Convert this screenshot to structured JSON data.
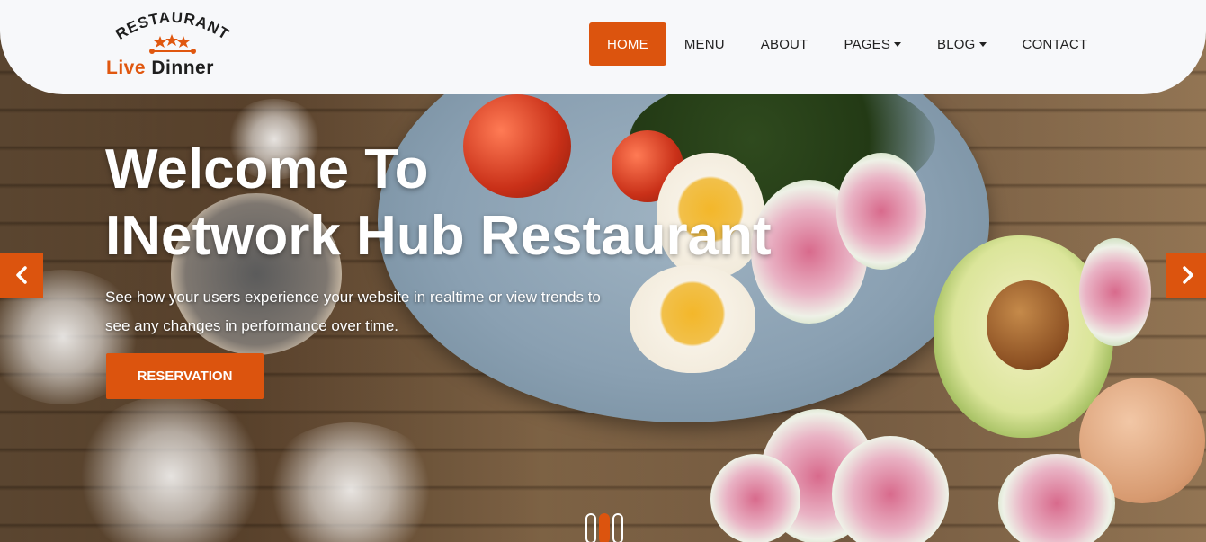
{
  "logo": {
    "arc_text": "RESTAURANT",
    "name_part1": "Live",
    "name_part2": "Dinner"
  },
  "nav": {
    "items": [
      {
        "label": "HOME",
        "active": true,
        "dropdown": false
      },
      {
        "label": "MENU",
        "active": false,
        "dropdown": false
      },
      {
        "label": "ABOUT",
        "active": false,
        "dropdown": false
      },
      {
        "label": "PAGES",
        "active": false,
        "dropdown": true
      },
      {
        "label": "BLOG",
        "active": false,
        "dropdown": true
      },
      {
        "label": "CONTACT",
        "active": false,
        "dropdown": false
      }
    ]
  },
  "hero": {
    "title_line1": "Welcome To",
    "title_line2": "INetwork Hub Restaurant",
    "description": "See how your users experience your website in realtime or view trends to see any changes in performance over time.",
    "button_label": "RESERVATION"
  },
  "carousel": {
    "prev_icon": "chevron-left-icon",
    "next_icon": "chevron-right-icon",
    "slide_count": 3,
    "active_index": 1
  },
  "colors": {
    "accent": "#dc540e",
    "header_bg": "#f7f8fa",
    "nav_text": "#222222"
  }
}
